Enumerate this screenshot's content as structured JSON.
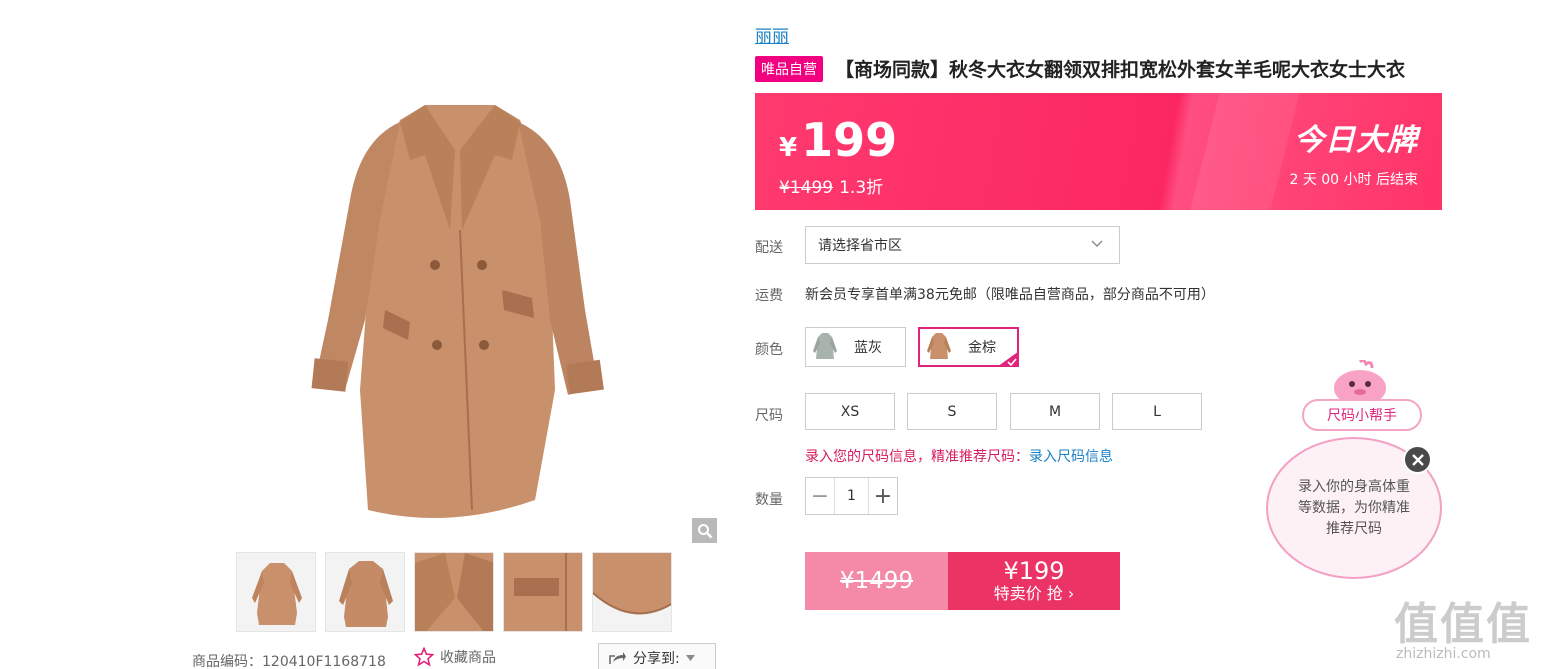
{
  "gallery": {
    "thumbnail_count": 5,
    "sku_code": "商品编码：120410F1168718",
    "favorite_label": "收藏商品",
    "share_label": "分享到:"
  },
  "product": {
    "brand": "丽丽",
    "self_badge": "唯品自营",
    "title": "【商场同款】秋冬大衣女翻领双排扣宽松外套女羊毛呢大衣女士大衣"
  },
  "price_banner": {
    "currency": "¥",
    "price": "199",
    "original_price": "¥1499",
    "discount": "1.3折",
    "promo_name": "今日大牌",
    "countdown": "2 天 00 小时 后结束"
  },
  "fields": {
    "delivery_label": "配送",
    "delivery_value": "请选择省市区",
    "shipping_label": "运费",
    "shipping_text": "新会员专享首单满38元免邮（限唯品自营商品，部分商品不可用）",
    "color_label": "颜色",
    "size_label": "尺码",
    "quantity_label": "数量"
  },
  "colors": [
    {
      "name": "蓝灰",
      "selected": false
    },
    {
      "name": "金棕",
      "selected": true
    }
  ],
  "sizes": [
    "XS",
    "S",
    "M",
    "L"
  ],
  "size_hint": {
    "text": "录入您的尺码信息，精准推荐尺码：",
    "link": "录入尺码信息"
  },
  "quantity": {
    "value": "1",
    "minus": "−",
    "plus": "+"
  },
  "buy_button": {
    "original_price": "¥1499",
    "price": "¥199",
    "action": "特卖价 抢 ›"
  },
  "size_helper": {
    "label": "尺码小帮手",
    "bubble_text": "录入你的身高体重等数据，为你精准推荐尺码"
  },
  "watermark": {
    "logo": "值值值",
    "url": "zhizhizhi.com"
  },
  "colors_theme": {
    "accent_pink": "#ec3366",
    "banner_pink": "#fb2763",
    "coat_brown": "#c8906b",
    "link_blue": "#1c80c6"
  }
}
